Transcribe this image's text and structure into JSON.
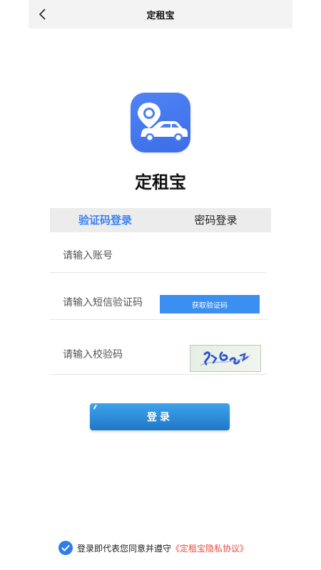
{
  "header": {
    "title": "定租宝"
  },
  "app": {
    "name": "定租宝"
  },
  "tabs": [
    {
      "label": "验证码登录",
      "active": true
    },
    {
      "label": "密码登录",
      "active": false
    }
  ],
  "form": {
    "account_placeholder": "请输入账号",
    "sms_placeholder": "请输入短信验证码",
    "sms_button": "获取验证码",
    "captcha_placeholder": "请输入校验码",
    "login_button": "登录"
  },
  "agreement": {
    "text": "登录即代表您同意并遵守",
    "link": "《定租宝隐私协议》",
    "checked": true
  },
  "colors": {
    "accent": "#3b83f3",
    "button_blue": "#3b8ff0",
    "link_red": "#e84c3d",
    "header_bg": "#f3f3f3"
  },
  "icons": [
    "back-icon",
    "app-logo-icon",
    "check-icon",
    "captcha-image"
  ]
}
